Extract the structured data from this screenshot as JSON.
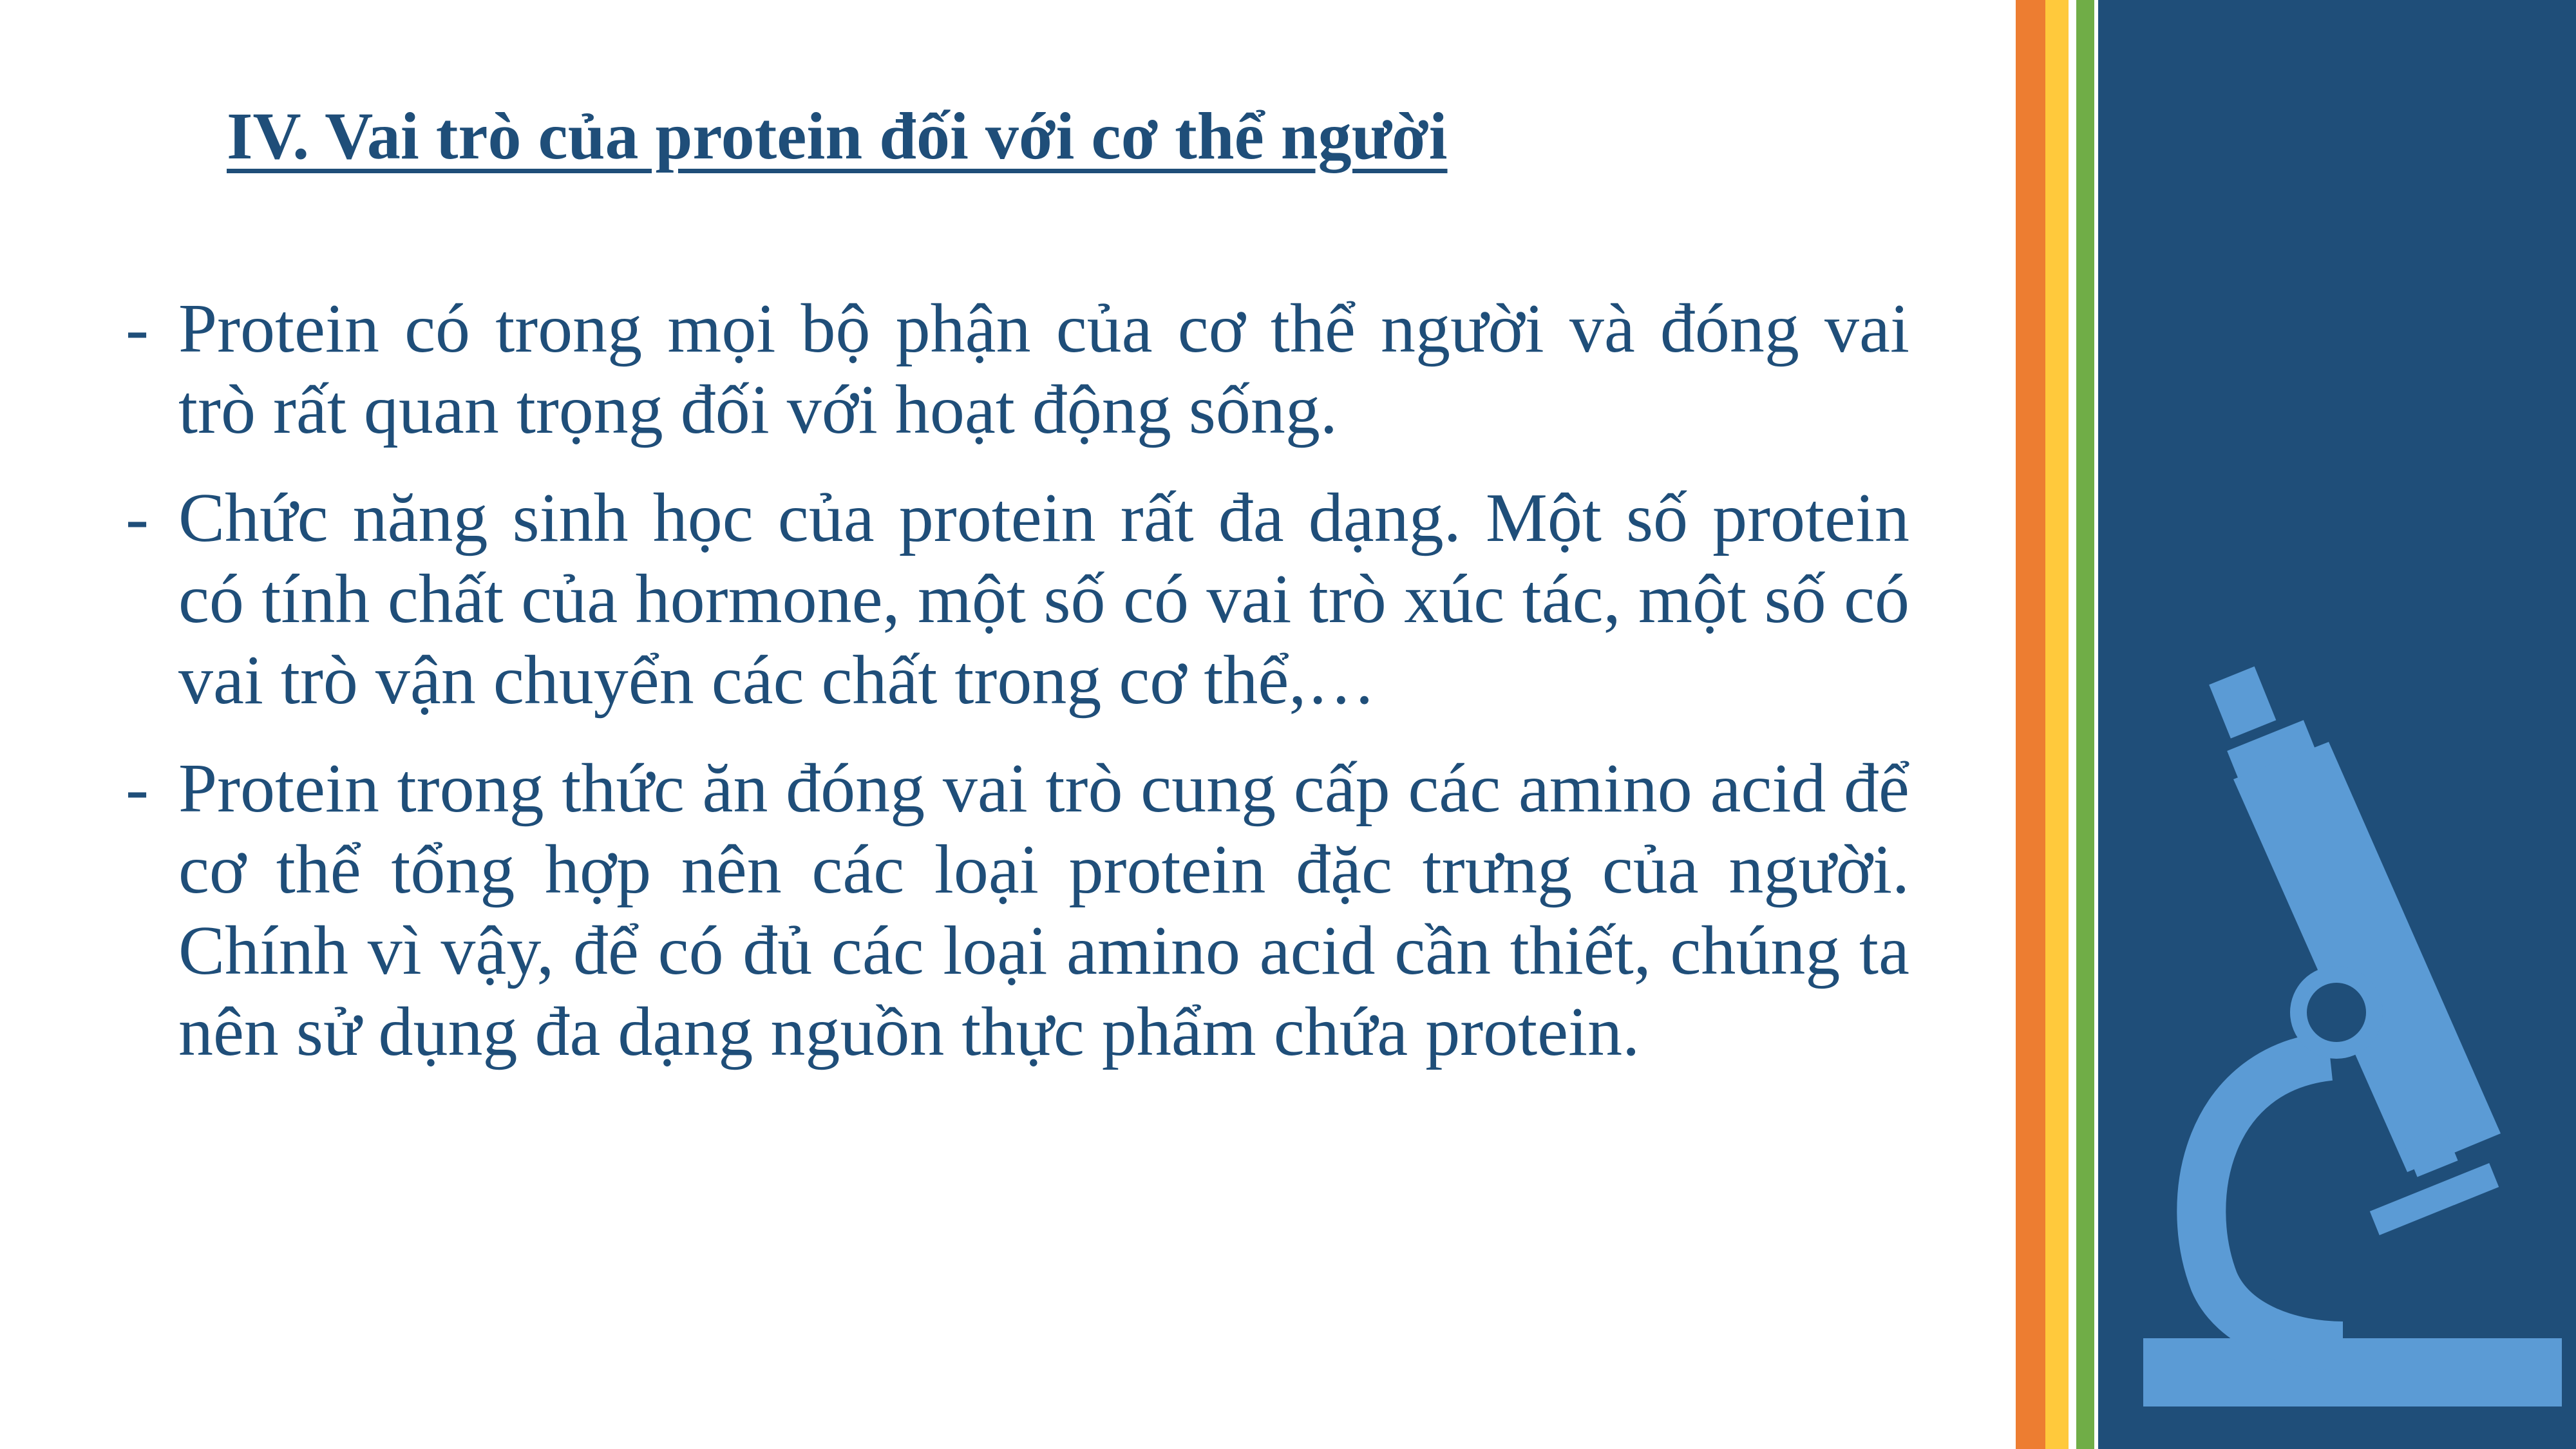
{
  "slide": {
    "title": "IV. Vai trò của protein đối với cơ thể người",
    "bullet_marker": "-",
    "bullets": [
      "Protein có trong mọi bộ phận của cơ thể người và đóng vai trò rất quan trọng đối với hoạt động sống.",
      "Chức năng sinh học của protein rất đa dạng. Một số protein có tính chất của hormone, một số có vai trò xúc tác, một số có vai trò vận chuyển các chất trong cơ thể,…",
      "Protein trong thức ăn đóng vai trò cung cấp các amino acid để cơ thể tổng hợp nên các loại protein đặc trưng của người. Chính vì vậy, để có đủ các loại amino acid cần thiết, chúng ta nên sử dụng đa dạng nguồn thực phẩm chứa protein."
    ]
  },
  "decor": {
    "text_color": "#1F4E79",
    "panel_color": "#1F4E79",
    "microscope_color": "#5B9BD5",
    "stripe_colors": [
      "#ED7D31",
      "#FFC93C",
      "#70AD47"
    ],
    "icon": "microscope-icon"
  }
}
